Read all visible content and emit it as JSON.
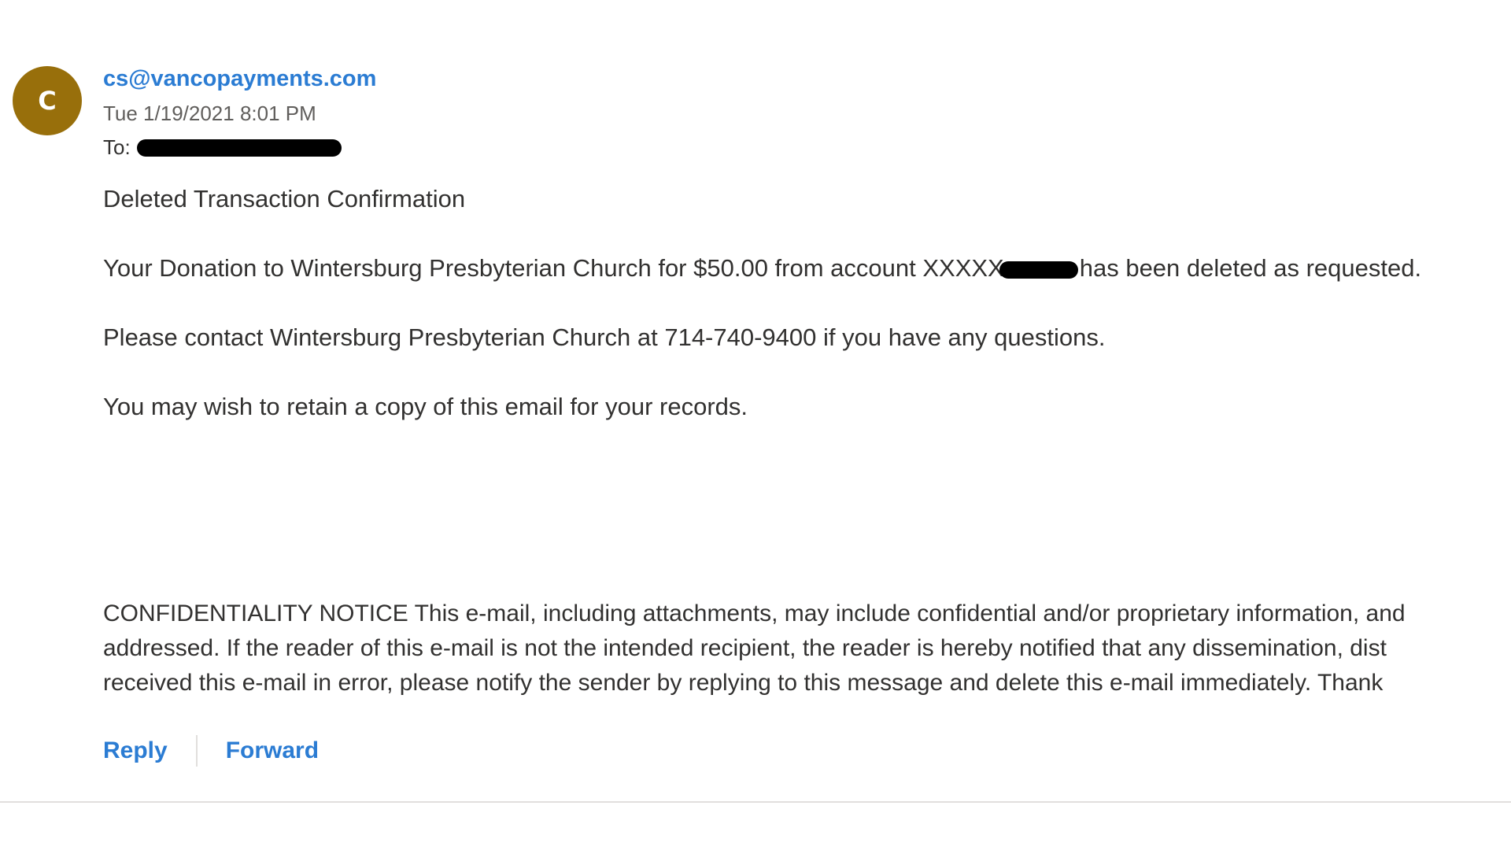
{
  "colors": {
    "accent": "#2b7cd3",
    "avatar_bg": "#986f0b",
    "text": "#323130",
    "muted": "#605e5c"
  },
  "header": {
    "avatar_initial": "C",
    "sender": "cs@vancopayments.com",
    "date": "Tue 1/19/2021 8:01 PM",
    "to_label": "To:"
  },
  "body": {
    "subject_line": "Deleted Transaction Confirmation",
    "donation_prefix": "Your Donation to Wintersburg Presbyterian Church for $50.00 from account XXXXX",
    "donation_suffix": "has been deleted as requested.",
    "contact": "Please contact Wintersburg Presbyterian Church at 714-740-9400 if you have any questions.",
    "retain": "You may wish to retain a copy of this email for your records.",
    "notice_lines": [
      "CONFIDENTIALITY NOTICE This e-mail, including attachments, may include confidential and/or proprietary information, and",
      "addressed. If the reader of this e-mail is not the intended recipient, the reader is hereby notified that any dissemination, dist",
      "received this e-mail in error, please notify the sender by replying to this message and delete this e-mail immediately. Thank"
    ]
  },
  "actions": {
    "reply": "Reply",
    "forward": "Forward"
  }
}
